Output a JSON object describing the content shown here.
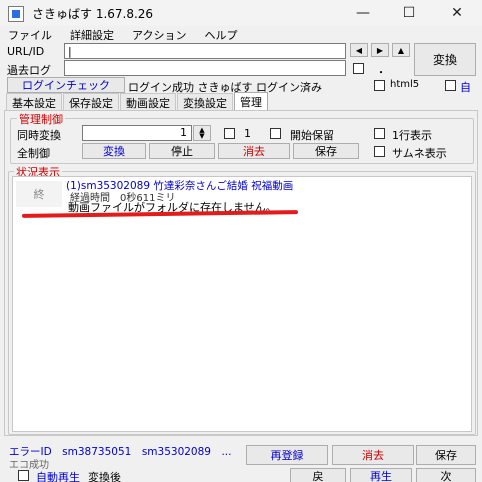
{
  "window": {
    "title": "さきゅばす 1.67.8.26",
    "minimize_glyph": "—",
    "maximize_glyph": "☐",
    "close_glyph": "✕"
  },
  "menu": [
    "ファイル",
    "詳細設定",
    "アクション",
    "ヘルプ"
  ],
  "form": {
    "url_label": "URL/ID",
    "url_value": "",
    "pastlog_label": "過去ログ",
    "pastlog_value": "",
    "nav_prev": "◀",
    "nav_next": "▶",
    "nav_up": "▲",
    "convert_button": "変換",
    "pastlog_dot": "・"
  },
  "login": {
    "check_button": "ログインチェック",
    "status_text": "ログイン成功 さきゅばす ログイン済み",
    "html5_label": "html5",
    "auto_label": "自"
  },
  "tabs": [
    "基本設定",
    "保存設定",
    "動画設定",
    "変換設定",
    "管理"
  ],
  "management": {
    "title": "管理制御",
    "simultaneous_label": "同時変換",
    "simultaneous_value": "1",
    "check1_label": "1",
    "start_hold_label": "開始保留",
    "one_line_label": "1行表示",
    "all_control_label": "全制御",
    "btn_convert": "変換",
    "btn_stop": "停止",
    "btn_clear": "消去",
    "btn_save": "保存",
    "thumbnail_label": "サムネ表示"
  },
  "status": {
    "title": "状況表示",
    "entry_title": "(1)sm35302089 竹達彩奈さんご結婚 祝福動画",
    "entry_badge": "終",
    "elapsed": "経過時間　0秒611ミリ",
    "message": "動画ファイルがフォルダに存在しません。"
  },
  "footer": {
    "error_ids": "エラーID　sm38735051　sm35302089　...",
    "eco_status": "エコ成功",
    "btn_reregister": "再登録",
    "btn_clear": "消去",
    "btn_save": "保存",
    "autoplay_label": "自動再生",
    "after_convert": "変換後",
    "btn_back": "戻",
    "btn_play": "再生",
    "btn_next": "次"
  },
  "colors": {
    "accent_blue": "#0000cc",
    "accent_red": "#cc0000",
    "annotation_red": "#e31b1b"
  }
}
